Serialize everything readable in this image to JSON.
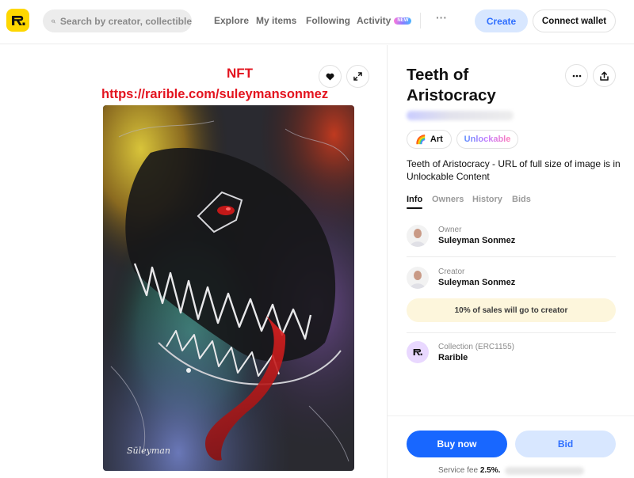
{
  "header": {
    "search_placeholder": "Search by creator, collectible",
    "nav": [
      {
        "label": "Explore"
      },
      {
        "label": "My items"
      },
      {
        "label": "Following"
      },
      {
        "label": "Activity",
        "badge": "NEW"
      }
    ],
    "more_label": "···",
    "create_label": "Create",
    "connect_wallet_label": "Connect wallet"
  },
  "overlay": {
    "nft_label": "NFT",
    "url_label": "https://rarible.com/suleymansonmez"
  },
  "artwork": {
    "signature": "Süleyman"
  },
  "item": {
    "title": "Teeth of Aristocracy",
    "tags": [
      {
        "label": "Art",
        "icon": "rainbow-icon"
      },
      {
        "label": "Unlockable"
      }
    ],
    "description": "Teeth of Aristocracy - URL of full size of image is in Unlockable Content",
    "tabs": [
      "Info",
      "Owners",
      "History",
      "Bids"
    ],
    "owner": {
      "label": "Owner",
      "name": "Suleyman Sonmez"
    },
    "creator": {
      "label": "Creator",
      "name": "Suleyman Sonmez"
    },
    "royalty_text": "10% of sales will go to creator",
    "collection": {
      "label": "Collection (ERC1155)",
      "name": "Rarible"
    }
  },
  "footer": {
    "buy_label": "Buy now",
    "bid_label": "Bid",
    "fee_prefix": "Service fee",
    "fee_value": "2.5%."
  },
  "colors": {
    "brand_yellow": "#fed700",
    "primary_blue": "#1867ff",
    "light_blue": "#d8e7ff",
    "overlay_red": "#e3141f",
    "royalty_bg": "#fdf6dc"
  }
}
